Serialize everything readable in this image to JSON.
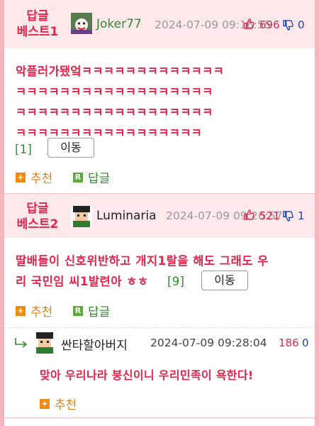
{
  "comments": [
    {
      "tag": "답글\n베스트1",
      "tag_line1": "답글",
      "tag_line2": "베스트1",
      "nickname": "Joker77",
      "date": "2024-07-09 09:16:55",
      "up": "696",
      "down": "0",
      "avatar_icon": "joker-avatar-icon",
      "body": "악플러가됐엌ㅋㅋㅋㅋㅋㅋㅋㅋㅋㅋㅋㅋㅋㅋㅋㅋㅋㅋㅋㅋㅋㅋㅋㅋㅋㅋㅋㅋㅋㅋㅋㅋㅋㅋㅋㅋㅋㅋㅋㅋㅋㅋㅋㅋㅋㅋㅋㅋㅋㅋㅋㅋㅋㅋㅋㅋㅋㅋㅋㅋㅋㅋㅋㅋㅋㅋㅋ",
      "body_lines": [
        "악플러가됐엌ㅋㅋㅋㅋㅋㅋㅋㅋㅋㅋㅋㅋㅋ",
        "ㅋㅋㅋㅋㅋㅋㅋㅋㅋㅋㅋㅋㅋㅋㅋㅋㅋㅋ",
        "ㅋㅋㅋㅋㅋㅋㅋㅋㅋㅋㅋㅋㅋㅋㅋㅋㅋㅋ",
        "ㅋㅋㅋㅋㅋㅋㅋㅋㅋㅋㅋㅋㅋㅋㅋㅋㅋ"
      ],
      "reply_count": "[1]",
      "move_label": "이동",
      "recommend_label": "추천",
      "reply_label": "답글"
    },
    {
      "tag_line1": "답글",
      "tag_line2": "베스트2",
      "nickname": "Luminaria",
      "date": "2024-07-09 09:26:57",
      "up": "521",
      "down": "1",
      "avatar_icon": "pixel-avatar-icon",
      "body_lines": [
        "딸배들이 신호위반하고 개지1랄을 해도 그래도 우",
        "리 국민임 씨1발련아 ㅎㅎ"
      ],
      "reply_count": "[9]",
      "move_label": "이동",
      "recommend_label": "추천",
      "reply_label": "답글"
    }
  ],
  "reply": {
    "nickname": "싼타할아버지",
    "date": "2024-07-09 09:28:04",
    "up": "186",
    "down": "0",
    "avatar_icon": "pixel-avatar-icon",
    "body": "맞아 우리나라 붕신이니 우리민족이 욕한다!",
    "recommend_label": "추천"
  },
  "icons": {
    "recommend_icon_label": "+",
    "reply_icon_label": "R"
  },
  "colors": {
    "accent": "#e4244b",
    "best_bg": "#fde8eb",
    "frame": "#f6b6bf",
    "recommend_text": "#d8841a",
    "recommend_icon_bg": "#f08a12",
    "reply_icon_bg": "#5aaa3c",
    "down_color": "#1b3fb3",
    "reply_count": "#2f8a2f"
  }
}
